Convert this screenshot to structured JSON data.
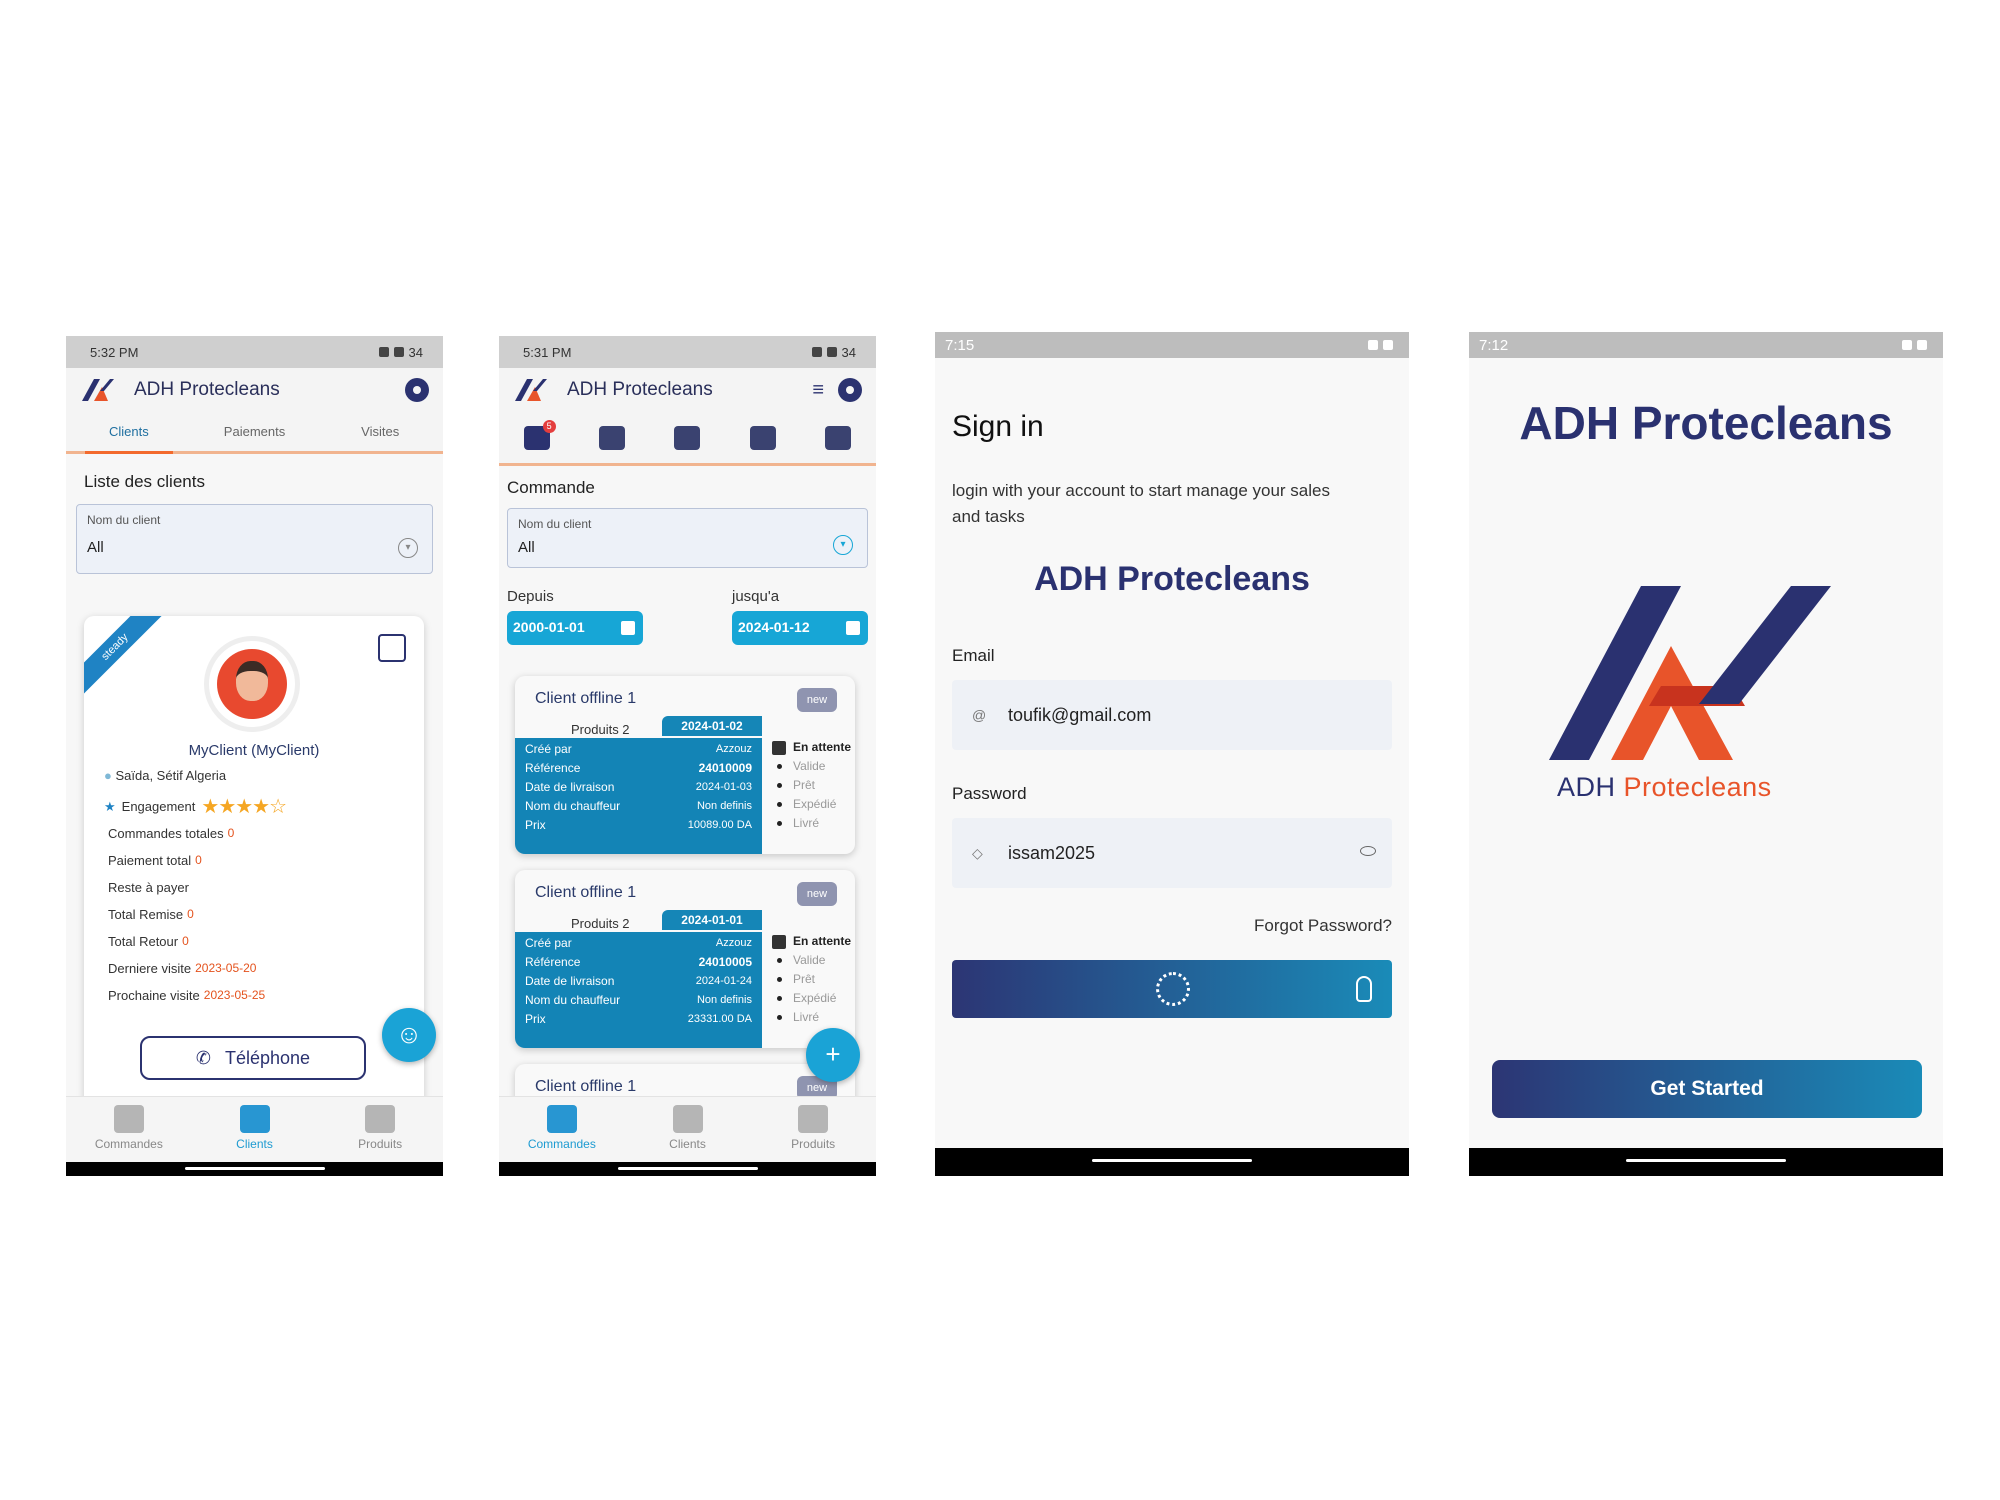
{
  "brand": {
    "accent": "#1aa3d6",
    "navy": "#2a3170",
    "orange": "#e8542a"
  },
  "screen1": {
    "status_time": "5:32 PM",
    "battery": "34",
    "app_title": "ADH Protecleans",
    "tabs": [
      "Clients",
      "Paiements",
      "Visites"
    ],
    "section_title": "Liste des clients",
    "filter": {
      "label": "Nom du client",
      "value": "All"
    },
    "card": {
      "ribbon": "steady",
      "name": "MyClient (MyClient)",
      "location": "Saïda, Sétif Algeria",
      "engagement_label": "Engagement",
      "rating": 4,
      "rating_max": 5,
      "stars": "★★★★☆",
      "stats": [
        {
          "label": "Commandes totales",
          "value": "0"
        },
        {
          "label": "Paiement total",
          "value": "0"
        },
        {
          "label": "Reste à payer",
          "value": ""
        },
        {
          "label": "Total Remise",
          "value": "0"
        },
        {
          "label": "Total Retour",
          "value": "0"
        },
        {
          "label": "Derniere visite",
          "value": "2023-05-20"
        },
        {
          "label": "Prochaine visite",
          "value": "2023-05-25"
        }
      ],
      "phone_button": "Téléphone"
    },
    "nav": [
      "Commandes",
      "Clients",
      "Produits"
    ]
  },
  "screen2": {
    "status_time": "5:31 PM",
    "battery": "34",
    "app_title": "ADH Protecleans",
    "cart_badge": "5",
    "section_title": "Commande",
    "filter": {
      "label": "Nom du client",
      "value": "All"
    },
    "from_label": "Depuis",
    "to_label": "jusqu'a",
    "from_date": "2000-01-01",
    "to_date": "2024-01-12",
    "orders": [
      {
        "title": "Client offline 1",
        "badge": "new",
        "products": "Produits  2",
        "date": "2024-01-02",
        "rows": [
          {
            "k": "Créé par",
            "v": "Azzouz"
          },
          {
            "k": "Référence",
            "v": "24010009"
          },
          {
            "k": "Date de livraison",
            "v": "2024-01-03"
          },
          {
            "k": "Nom du chauffeur",
            "v": "Non definis"
          },
          {
            "k": "Prix",
            "v": "10089.00 DA"
          }
        ],
        "statuses": [
          "En attente",
          "Valide",
          "Prêt",
          "Expédié",
          "Livré"
        ]
      },
      {
        "title": "Client offline 1",
        "badge": "new",
        "products": "Produits  2",
        "date": "2024-01-01",
        "rows": [
          {
            "k": "Créé par",
            "v": "Azzouz"
          },
          {
            "k": "Référence",
            "v": "24010005"
          },
          {
            "k": "Date de livraison",
            "v": "2024-01-24"
          },
          {
            "k": "Nom du chauffeur",
            "v": "Non definis"
          },
          {
            "k": "Prix",
            "v": "23331.00 DA"
          }
        ],
        "statuses": [
          "En attente",
          "Valide",
          "Prêt",
          "Expédié",
          "Livré"
        ]
      }
    ],
    "partial_title": "Client offline 1",
    "partial_badge": "new",
    "fab": "+",
    "nav": [
      "Commandes",
      "Clients",
      "Produits"
    ]
  },
  "screen3": {
    "status_time": "7:15",
    "title": "Sign in",
    "subtitle": "login with your account to start manage your sales and tasks",
    "brand": "ADH Protecleans",
    "email_label": "Email",
    "email_value": "toufik@gmail.com",
    "password_label": "Password",
    "password_value": "issam2025",
    "forgot": "Forgot Password?"
  },
  "screen4": {
    "status_time": "7:12",
    "title": "ADH Protecleans",
    "logo_text_a": "ADH",
    "logo_text_b": "Protecleans",
    "button": "Get Started"
  }
}
